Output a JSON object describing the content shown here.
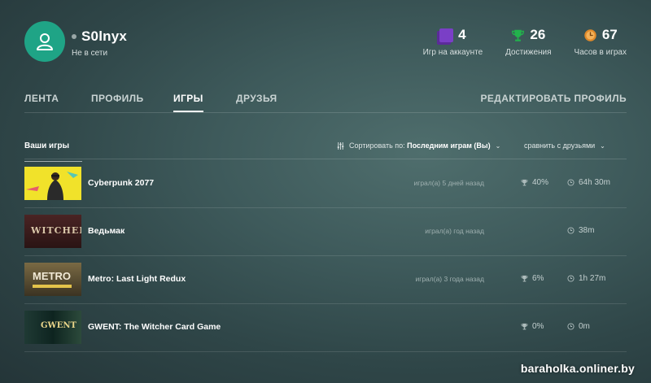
{
  "profile": {
    "username": "S0lnyx",
    "status": "Не в сети"
  },
  "stats": [
    {
      "value": "4",
      "label": "Игр на аккаунте",
      "icon": "games-icon",
      "color": "#7a3fc6"
    },
    {
      "value": "26",
      "label": "Достижения",
      "icon": "trophy-icon",
      "color": "#22b24c"
    },
    {
      "value": "67",
      "label": "Часов в играх",
      "icon": "clock-icon",
      "color": "#e08a2a"
    }
  ],
  "nav": {
    "tabs": [
      "ЛЕНТА",
      "ПРОФИЛЬ",
      "ИГРЫ",
      "ДРУЗЬЯ"
    ],
    "active": "ИГРЫ",
    "edit_profile": "РЕДАКТИРОВАТЬ ПРОФИЛЬ"
  },
  "list": {
    "title": "Ваши игры",
    "sort_prefix": "Сортировать по:",
    "sort_value": "Последним играм (Вы)",
    "compare": "сравнить с друзьями"
  },
  "games": [
    {
      "title": "Cyberpunk 2077",
      "played": "играл(а) 5 дней назад",
      "achievements": "40%",
      "time": "64h 30m",
      "cover": "cyberpunk-cover"
    },
    {
      "title": "Ведьмак",
      "played": "играл(а) год назад",
      "achievements": "",
      "time": "38m",
      "cover": "witcher-cover",
      "cover_text": "WITCHER"
    },
    {
      "title": "Metro: Last Light Redux",
      "played": "играл(а) 3 года назад",
      "achievements": "6%",
      "time": "1h 27m",
      "cover": "metro-cover",
      "cover_text": "METRO"
    },
    {
      "title": "GWENT: The Witcher Card Game",
      "played": "",
      "achievements": "0%",
      "time": "0m",
      "cover": "gwent-cover",
      "cover_text": "GWENT"
    }
  ],
  "watermark": "baraholka.onliner.by"
}
